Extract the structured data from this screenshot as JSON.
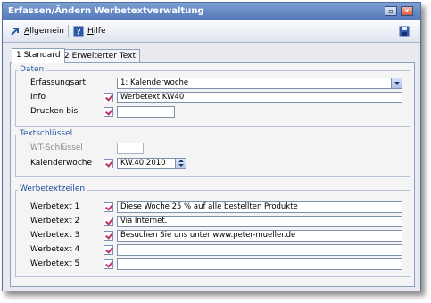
{
  "window": {
    "title": "Erfassen/Ändern Werbetextverwaltung",
    "minimize_glyph": "▫",
    "close_glyph": "✕"
  },
  "toolbar": {
    "allgemein_label": "Allgemein",
    "allgemein_accel": "A",
    "allgemein_rest": "llgemein",
    "hilfe_label": "Hilfe",
    "hilfe_accel": "H",
    "hilfe_rest": "ilfe",
    "save_icon": "save-icon"
  },
  "tabs": [
    {
      "label": "1 Standard",
      "active": true
    },
    {
      "label": "2 Erweiterter Text",
      "active": false
    }
  ],
  "daten": {
    "legend": "Daten",
    "erfassungsart_label": "Erfassungsart",
    "erfassungsart_value": "1: Kalenderwoche",
    "info_label": "Info",
    "info_value": "Werbetext KW40",
    "drucken_bis_label": "Drucken bis",
    "drucken_bis_value": ""
  },
  "textschluessel": {
    "legend": "Textschlüssel",
    "wt_schluessel_label": "WT-Schlüssel",
    "wt_schluessel_value": "",
    "kalenderwoche_label": "Kalenderwoche",
    "kalenderwoche_value": "KW.40.2010"
  },
  "werbetextzeilen": {
    "legend": "Werbetextzeilen",
    "rows": [
      {
        "label": "Werbetext 1",
        "value": "Diese Woche 25 % auf alle bestellten Produkte"
      },
      {
        "label": "Werbetext 2",
        "value": "Via Internet."
      },
      {
        "label": "Werbetext 3",
        "value": "Besuchen Sie uns unter www.peter-mueller.de"
      },
      {
        "label": "Werbetext 4",
        "value": ""
      },
      {
        "label": "Werbetext 5",
        "value": ""
      }
    ]
  },
  "colors": {
    "title_bar": "#5a7dbc",
    "accent_legend": "#2c5ca8",
    "check_mark": "#c0306f"
  }
}
